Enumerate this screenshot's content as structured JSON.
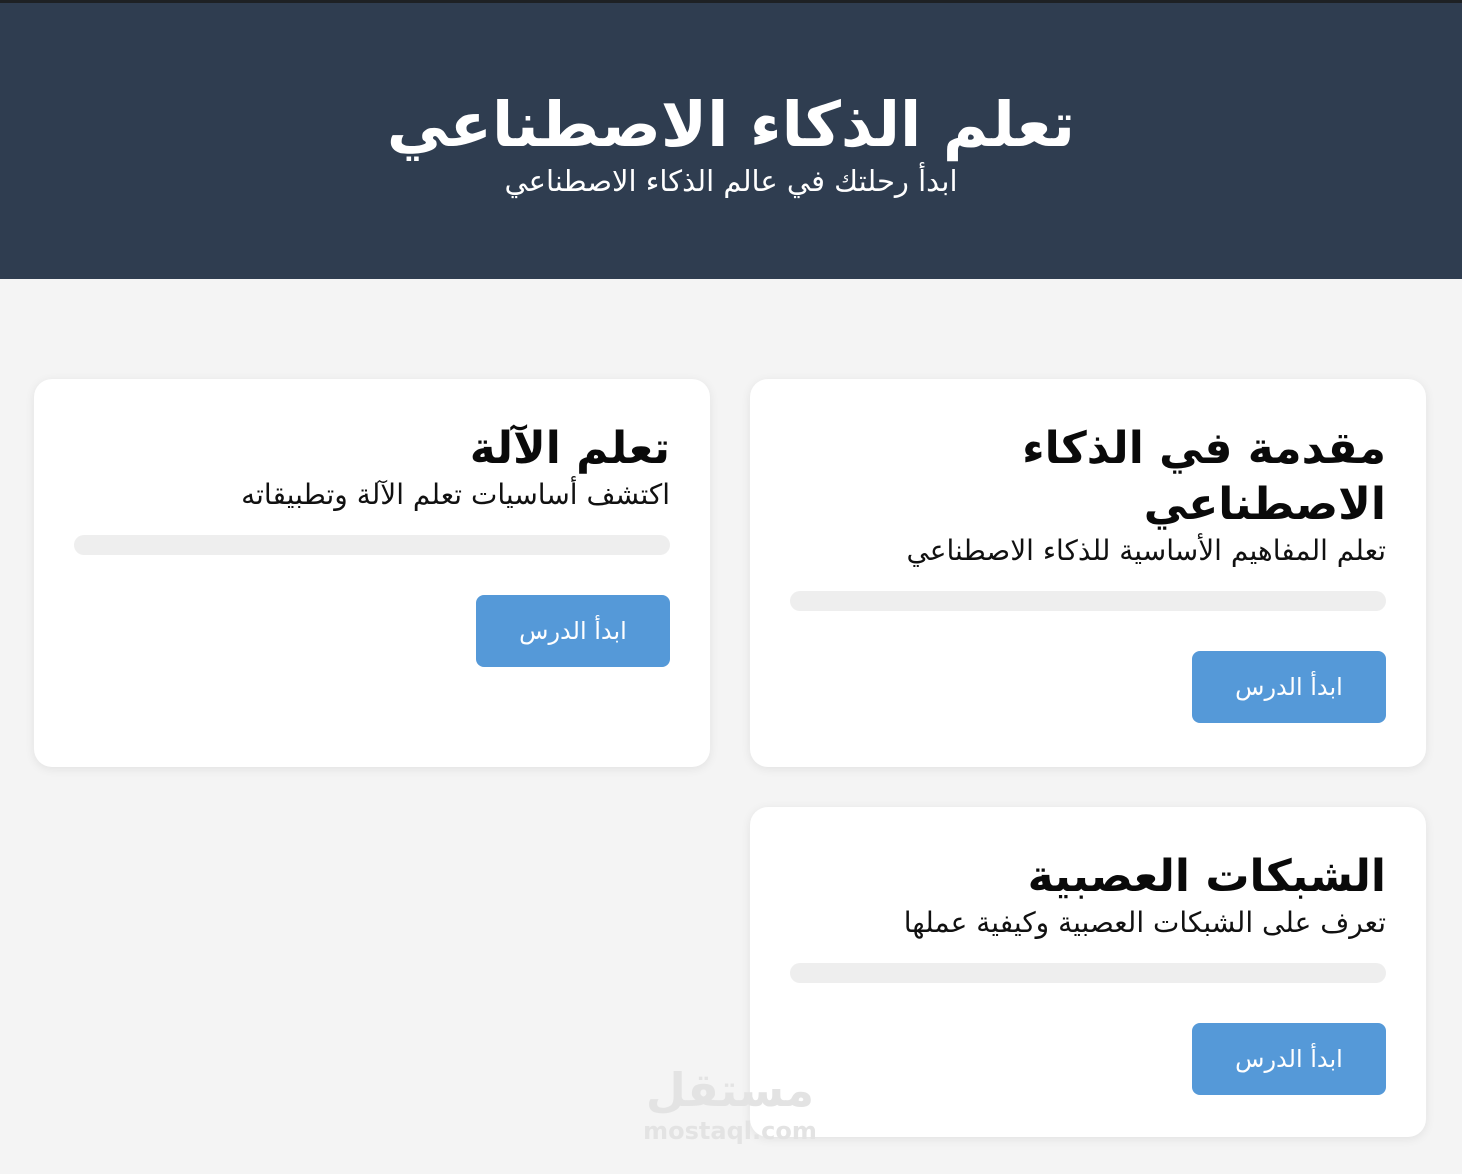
{
  "header": {
    "title": "تعلم الذكاء الاصطناعي",
    "subtitle": "ابدأ رحلتك في عالم الذكاء الاصطناعي"
  },
  "courses": [
    {
      "title": "مقدمة في الذكاء الاصطناعي",
      "description": "تعلم المفاهيم الأساسية للذكاء الاصطناعي",
      "progress": 0,
      "button_label": "ابدأ الدرس"
    },
    {
      "title": "تعلم الآلة",
      "description": "اكتشف أساسيات تعلم الآلة وتطبيقاته",
      "progress": 0,
      "button_label": "ابدأ الدرس"
    },
    {
      "title": "الشبكات العصبية",
      "description": "تعرف على الشبكات العصبية وكيفية عملها",
      "progress": 0,
      "button_label": "ابدأ الدرس"
    }
  ],
  "watermark": {
    "brand": "مستقل",
    "domain": "mostaql.com"
  },
  "colors": {
    "header_bg": "#2f3d50",
    "page_bg": "#f4f4f4",
    "accent": "#5599d8",
    "track": "#eeeeee"
  }
}
